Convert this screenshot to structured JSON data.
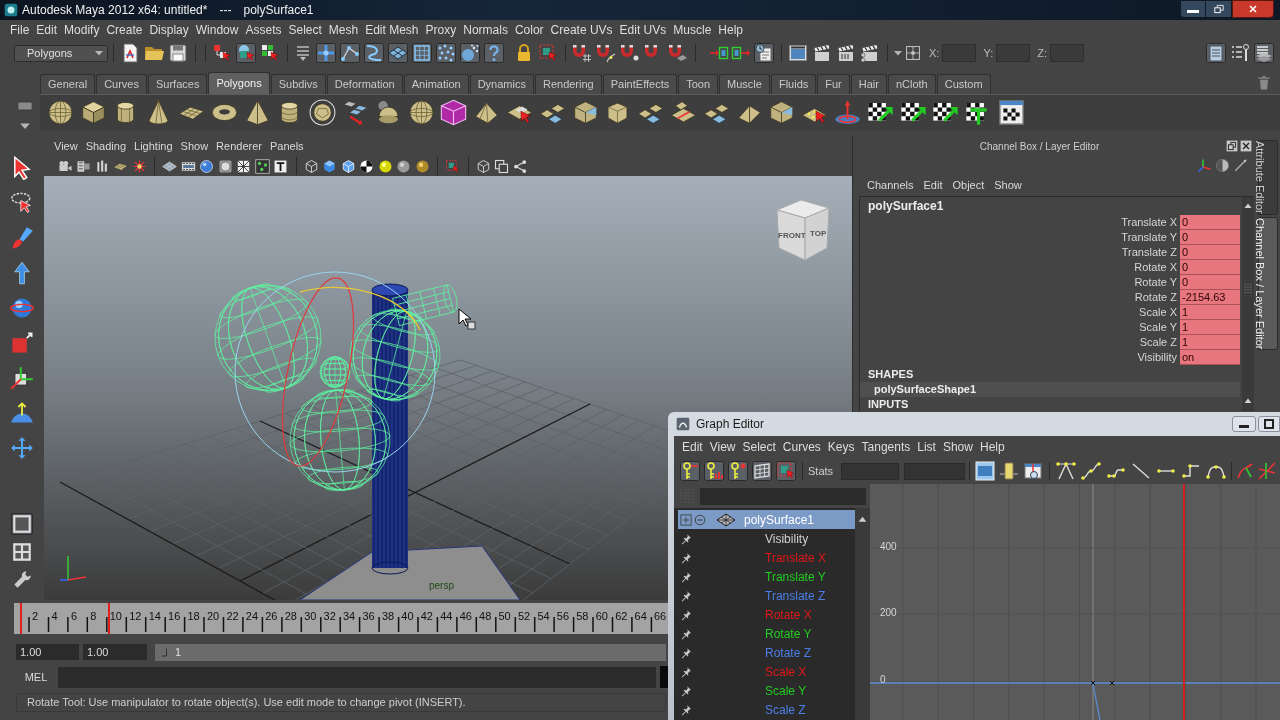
{
  "title_bar": {
    "title": "Autodesk Maya 2012 x64: untitled*",
    "separator": "---",
    "object": "polySurface1"
  },
  "menu_bar": [
    "File",
    "Edit",
    "Modify",
    "Create",
    "Display",
    "Window",
    "Assets",
    "Select",
    "Mesh",
    "Edit Mesh",
    "Proxy",
    "Normals",
    "Color",
    "Create UVs",
    "Edit UVs",
    "Muscle",
    "Help"
  ],
  "status_line": {
    "menu_set": "Polygons",
    "coordinates": [
      {
        "label": "X:"
      },
      {
        "label": "Y:"
      },
      {
        "label": "Z:"
      }
    ]
  },
  "shelf": {
    "tabs": [
      {
        "label": "General",
        "selected": false
      },
      {
        "label": "Curves",
        "selected": false
      },
      {
        "label": "Surfaces",
        "selected": false
      },
      {
        "label": "Polygons",
        "selected": true
      },
      {
        "label": "Subdivs",
        "selected": false
      },
      {
        "label": "Deformation",
        "selected": false
      },
      {
        "label": "Animation",
        "selected": false
      },
      {
        "label": "Dynamics",
        "selected": false
      },
      {
        "label": "Rendering",
        "selected": false
      },
      {
        "label": "PaintEffects",
        "selected": false
      },
      {
        "label": "Toon",
        "selected": false
      },
      {
        "label": "Muscle",
        "selected": false
      },
      {
        "label": "Fluids",
        "selected": false
      },
      {
        "label": "Fur",
        "selected": false
      },
      {
        "label": "Hair",
        "selected": false
      },
      {
        "label": "nCloth",
        "selected": false
      },
      {
        "label": "Custom",
        "selected": false
      }
    ]
  },
  "viewport": {
    "menus": [
      "View",
      "Shading",
      "Lighting",
      "Show",
      "Renderer",
      "Panels"
    ],
    "view_cube": [
      "FRONT",
      "TOP"
    ],
    "camera": "persp"
  },
  "channel_box": {
    "title": "Channel Box / Layer Editor",
    "menus": [
      "Channels",
      "Edit",
      "Object",
      "Show"
    ],
    "object": "polySurface1",
    "attributes": [
      {
        "name": "Translate X",
        "value": "0",
        "keyed": true
      },
      {
        "name": "Translate Y",
        "value": "0",
        "keyed": true
      },
      {
        "name": "Translate Z",
        "value": "0",
        "keyed": true
      },
      {
        "name": "Rotate X",
        "value": "0",
        "keyed": true
      },
      {
        "name": "Rotate Y",
        "value": "0",
        "keyed": true
      },
      {
        "name": "Rotate Z",
        "value": "-2154.63",
        "keyed": true
      },
      {
        "name": "Scale X",
        "value": "1",
        "keyed": true
      },
      {
        "name": "Scale Y",
        "value": "1",
        "keyed": true
      },
      {
        "name": "Scale Z",
        "value": "1",
        "keyed": true
      },
      {
        "name": "Visibility",
        "value": "on",
        "keyed": true
      }
    ],
    "shapes_header": "SHAPES",
    "shape": "polySurfaceShape1",
    "inputs_header": "INPUTS"
  },
  "side_tabs": [
    {
      "label": "Attribute Editor",
      "selected": false
    },
    {
      "label": "Channel Box / Layer Editor",
      "selected": true
    }
  ],
  "timeline": {
    "frames": [
      "2",
      "4",
      "6",
      "8",
      "10",
      "12",
      "14",
      "16",
      "18",
      "20",
      "22",
      "24",
      "26",
      "28",
      "30",
      "32",
      "34",
      "36",
      "38",
      "40",
      "42",
      "44",
      "46",
      "48",
      "50",
      "52",
      "54",
      "56",
      "58",
      "60",
      "62",
      "64",
      "66"
    ],
    "markers": [
      {
        "level": 0.009
      },
      {
        "level": 0.144
      }
    ]
  },
  "range_slider": {
    "start": "1.00",
    "playback_start": "1.00",
    "level": 1,
    "bar_label": "1"
  },
  "command_line": {
    "language": "MEL"
  },
  "help_line": "Rotate Tool: Use manipulator to rotate object(s). Use edit mode to change pivot (INSERT).",
  "graph_editor": {
    "title": "Graph Editor",
    "menus": [
      "Edit",
      "View",
      "Select",
      "Curves",
      "Keys",
      "Tangents",
      "List",
      "Show",
      "Help"
    ],
    "stats_label": "Stats",
    "outliner": {
      "node": {
        "label": "polySurface1",
        "selected": true
      },
      "channels": [
        {
          "label": "Visibility",
          "color": "#cfcfcf",
          "selected": false
        },
        {
          "label": "Translate X",
          "color": "#e01818",
          "selected": false
        },
        {
          "label": "Translate Y",
          "color": "#22cc22",
          "selected": false
        },
        {
          "label": "Translate Z",
          "color": "#4c7ee8",
          "selected": false
        },
        {
          "label": "Rotate X",
          "color": "#e01818",
          "selected": false
        },
        {
          "label": "Rotate Y",
          "color": "#22cc22",
          "selected": false
        },
        {
          "label": "Rotate Z",
          "color": "#4c7ee8",
          "selected": false
        },
        {
          "label": "Scale X",
          "color": "#e01818",
          "selected": false
        },
        {
          "label": "Scale Y",
          "color": "#22cc22",
          "selected": false
        },
        {
          "label": "Scale Z",
          "color": "#4c7ee8",
          "selected": false
        }
      ]
    },
    "graph": {
      "y_labels": [
        "400",
        "200",
        "0"
      ]
    }
  }
}
